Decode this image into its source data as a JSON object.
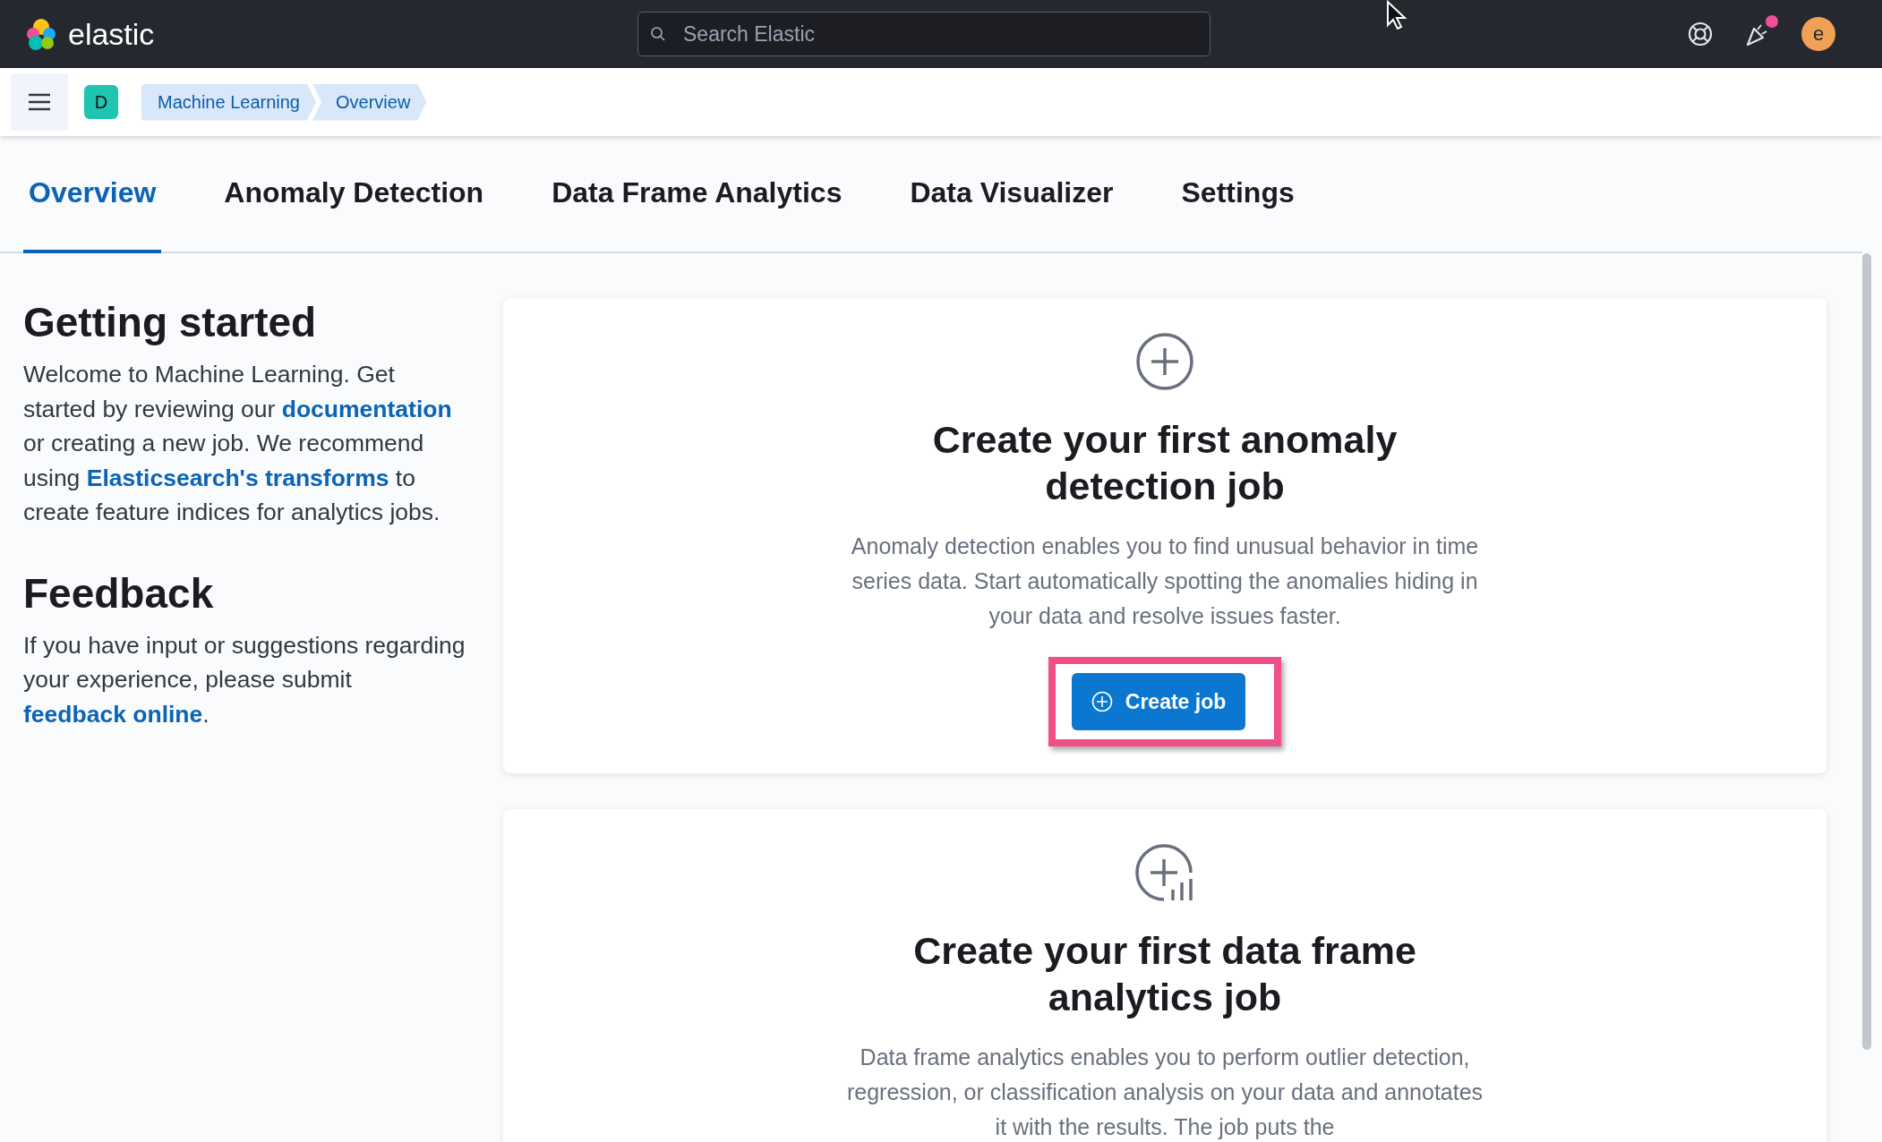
{
  "header": {
    "brand": "elastic",
    "search": {
      "placeholder": "Search Elastic"
    },
    "news_unread": true,
    "avatar": "e"
  },
  "breadcrumb_bar": {
    "space": "D",
    "breadcrumbs": [
      "Machine Learning",
      "Overview"
    ]
  },
  "tabs": [
    {
      "label": "Overview",
      "selected": true
    },
    {
      "label": "Anomaly Detection",
      "selected": false
    },
    {
      "label": "Data Frame Analytics",
      "selected": false
    },
    {
      "label": "Data Visualizer",
      "selected": false
    },
    {
      "label": "Settings",
      "selected": false
    }
  ],
  "sidebar": [
    {
      "heading": "Getting started",
      "paragraph": [
        {
          "kind": "text",
          "text": "Welcome to Machine Learning. Get started by reviewing our "
        },
        {
          "kind": "link",
          "text": "documentation"
        },
        {
          "kind": "text",
          "text": " or creating a new job. We recommend using "
        },
        {
          "kind": "link",
          "text": "Elasticsearch's transforms"
        },
        {
          "kind": "text",
          "text": " to create feature indices for analytics jobs."
        }
      ]
    },
    {
      "heading": "Feedback",
      "paragraph": [
        {
          "kind": "text",
          "text": "If you have input or suggestions regarding your experience, please submit "
        },
        {
          "kind": "link",
          "text": "feedback online"
        },
        {
          "kind": "text",
          "text": "."
        }
      ]
    }
  ],
  "cards": [
    {
      "kind": "anomaly",
      "title": "Create your first anomaly detection job",
      "description": "Anomaly detection enables you to find unusual behavior in time series data. Start automatically spotting the anomalies hiding in your data and resolve issues faster.",
      "button": "Create job",
      "highlighted": true
    },
    {
      "kind": "analytics",
      "title": "Create your first data frame analytics job",
      "description": "Data frame analytics enables you to perform outlier detection, regression, or classification analysis on your data and annotates it with the results. The job puts the"
    }
  ]
}
